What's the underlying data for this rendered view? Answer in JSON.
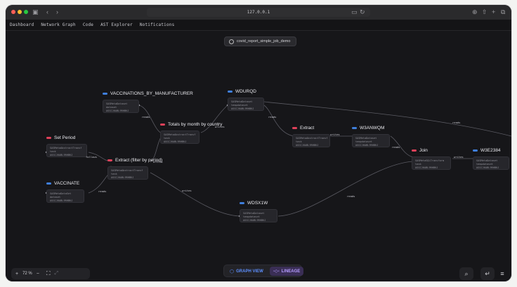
{
  "browser": {
    "url": "127.0.0.1",
    "icons": [
      "sidebar-icon",
      "chevron-left-icon",
      "chevron-right-icon",
      "download-icon",
      "share-icon",
      "new-tab-icon",
      "tabs-icon"
    ]
  },
  "nav": {
    "items": [
      "Dashboard",
      "Network Graph",
      "Code",
      "AST Explorer",
      "Notifications"
    ]
  },
  "job": {
    "name": "covid_report_simple_job_demo"
  },
  "colors": {
    "red": "#e0415a",
    "blue": "#3f7fdc",
    "canvas": "#161619"
  },
  "nodes": {
    "vaccinations": {
      "title": "VACCINATIONS_BY_MANUFACTURER",
      "l1": "SASMetaDataset",
      "l2": "dataset",
      "l3": "AGGCJ6ABL9RHBKJ"
    },
    "totals": {
      "title": "Totals by month by country",
      "l1": "SASMetaAbstractTransf",
      "l2": "task",
      "l3": "AGGCJ6ABL9RHBKJ"
    },
    "wdurqd": {
      "title": "WDURQD",
      "l1": "SASMetaDataset",
      "l2": "tempdataset",
      "l3": "AGGCJ6ABL9RHBKJ"
    },
    "setperiod": {
      "title": "Set Period",
      "l1": "SASMetaAbstractTransf",
      "l2": "task",
      "l3": "AGGCJ6ABL9RHBKJ"
    },
    "extract_filter": {
      "title": "Extract (filter by period)",
      "l1": "SASMetaAbstractTransf",
      "l2": "task",
      "l3": "AGGCJ6ABL9RHBKJ"
    },
    "vaccinate": {
      "title": "VACCINATE",
      "l1": "SASMetaDataSet",
      "l2": "dataset",
      "l3": "AGGCJ6ABL9RHBKJ"
    },
    "extract": {
      "title": "Extract",
      "l1": "SASMetaAbstractTransf",
      "l2": "task",
      "l3": "AGGCJ6ABL9RHBKJ"
    },
    "w3anwqm": {
      "title": "W3ANWQM",
      "l1": "SASMetaDataset",
      "l2": "tempdataset",
      "l3": "AGGCJ6ABL9RHBKJ"
    },
    "join": {
      "title": "Join",
      "l1": "SASMetaSQLTransform",
      "l2": "task",
      "l3": "AGGCJ6ABL9RHBKJ"
    },
    "w3e2384": {
      "title": "W3E2384",
      "l1": "SASMetaDataset",
      "l2": "tempdataset",
      "l3": "AGGCJ6ABL9RHBKJ"
    },
    "wdsx1w": {
      "title": "WDSX1W",
      "l1": "SASMetaDataset",
      "l2": "tempdataset",
      "l3": "AGGCJ6ABL9RHBKJ"
    }
  },
  "edges": {
    "reads": "reads",
    "writes": "writes",
    "follows": "follows"
  },
  "controls": {
    "zoom_in": "+",
    "zoom_level": "72 %",
    "zoom_out": "−",
    "graph_view": "GRAPH VIEW",
    "lineage": "LINEAGE"
  }
}
